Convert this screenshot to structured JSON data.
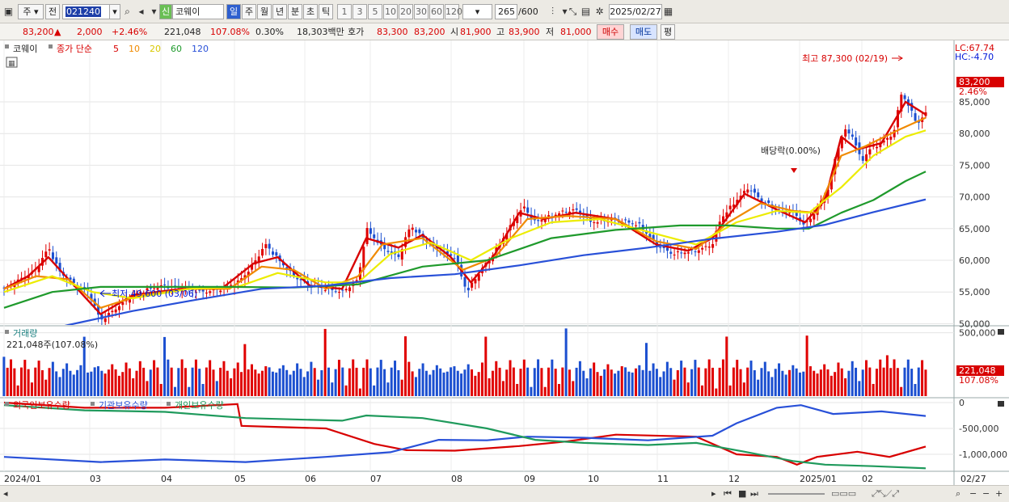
{
  "toolbar": {
    "period_unit": "주",
    "prev_label": "전",
    "code": "021240",
    "badge": "신",
    "name": "코웨이",
    "timeframes": [
      "일",
      "주",
      "월",
      "년",
      "분",
      "초",
      "틱"
    ],
    "numbers": [
      "1",
      "3",
      "5",
      "10",
      "20",
      "30",
      "60",
      "120"
    ],
    "count": "265",
    "count_total": "/600",
    "date": "2025/02/27"
  },
  "quote": {
    "price": "83,200",
    "arrow": "▲",
    "change": "2,000",
    "change_pct": "+2.46%",
    "volume": "221,048",
    "volume_pct": "107.08%",
    "turnover": "0.30%",
    "amount": "18,303백만",
    "ask_label": "호가",
    "ask": "83,300",
    "bid": "83,200",
    "open_label": "시",
    "open": "81,900",
    "high_label": "고",
    "high": "83,900",
    "low_label": "저",
    "low": "81,000",
    "buy_label": "매수",
    "sell_label": "매도",
    "extra_label": "평"
  },
  "price_panel": {
    "title": "코웨이",
    "legend_prefix": "종가 단순",
    "ma": [
      {
        "label": "5",
        "color": "#d80000"
      },
      {
        "label": "10",
        "color": "#f08a00"
      },
      {
        "label": "20",
        "color": "#e8e800"
      },
      {
        "label": "60",
        "color": "#1f9a2c"
      },
      {
        "label": "120",
        "color": "#2850d8"
      }
    ],
    "lc": "LC:67.74",
    "hc": "HC:-4.70",
    "yticks": [
      "85,000",
      "80,000",
      "75,000",
      "70,000",
      "65,000",
      "60,000",
      "55,000",
      "50,000"
    ],
    "last_price": "83,200",
    "last_pct": "2.46%",
    "high_note": "최고 87,300 (02/19)",
    "low_note": "최저 49,600 (03/06)",
    "dividend_note": "배당락(0.00%)"
  },
  "volume_panel": {
    "title": "거래량",
    "subtitle": "221,048주(107.08%)",
    "yticks": [
      "500,000"
    ],
    "last": "221,048",
    "last_pct": "107.08%"
  },
  "holding_panel": {
    "legend": [
      "외국인보유수량",
      "기관보유수량",
      "개인보유수량"
    ],
    "yticks": [
      "0",
      "-500,000",
      "-1,000,000"
    ]
  },
  "xaxis": [
    "2024/01",
    "03",
    "04",
    "05",
    "06",
    "07",
    "08",
    "09",
    "10",
    "11",
    "12",
    "2025/01",
    "02",
    "02/27"
  ],
  "chart_data": {
    "type": "line",
    "series": [
      {
        "name": "종가",
        "values": [
          [
            0,
            55500
          ],
          [
            20,
            57000
          ],
          [
            40,
            58500
          ],
          [
            55,
            62000
          ],
          [
            70,
            58000
          ],
          [
            90,
            56000
          ],
          [
            105,
            55000
          ],
          [
            120,
            50500
          ],
          [
            140,
            52500
          ],
          [
            160,
            54500
          ],
          [
            180,
            55500
          ],
          [
            200,
            56000
          ],
          [
            220,
            55500
          ],
          [
            250,
            55000
          ],
          [
            270,
            55500
          ],
          [
            290,
            56500
          ],
          [
            305,
            58500
          ],
          [
            325,
            62500
          ],
          [
            345,
            59500
          ],
          [
            360,
            57500
          ],
          [
            380,
            56000
          ],
          [
            400,
            55500
          ],
          [
            420,
            55000
          ],
          [
            440,
            57000
          ],
          [
            450,
            65000
          ],
          [
            470,
            62000
          ],
          [
            490,
            60500
          ],
          [
            505,
            65500
          ],
          [
            520,
            63500
          ],
          [
            540,
            61500
          ],
          [
            560,
            60500
          ],
          [
            575,
            55000
          ],
          [
            590,
            58000
          ],
          [
            610,
            61500
          ],
          [
            630,
            65500
          ],
          [
            645,
            68500
          ],
          [
            660,
            66000
          ],
          [
            690,
            67500
          ],
          [
            710,
            68000
          ],
          [
            730,
            66000
          ],
          [
            760,
            66500
          ],
          [
            790,
            65500
          ],
          [
            810,
            62500
          ],
          [
            830,
            61000
          ],
          [
            860,
            61500
          ],
          [
            880,
            62500
          ],
          [
            890,
            66500
          ],
          [
            910,
            69500
          ],
          [
            925,
            71500
          ],
          [
            940,
            69500
          ],
          [
            960,
            68000
          ],
          [
            980,
            67500
          ],
          [
            995,
            65500
          ],
          [
            1010,
            68000
          ],
          [
            1025,
            71500
          ],
          [
            1035,
            77500
          ],
          [
            1045,
            80500
          ],
          [
            1055,
            79500
          ],
          [
            1065,
            75500
          ],
          [
            1075,
            77500
          ],
          [
            1090,
            78500
          ],
          [
            1105,
            80000
          ],
          [
            1115,
            86500
          ],
          [
            1125,
            84000
          ],
          [
            1135,
            81500
          ],
          [
            1145,
            83200
          ]
        ]
      },
      {
        "name": "5",
        "values": [
          [
            0,
            55500
          ],
          [
            30,
            57500
          ],
          [
            55,
            60500
          ],
          [
            80,
            57000
          ],
          [
            120,
            51500
          ],
          [
            160,
            54500
          ],
          [
            220,
            55500
          ],
          [
            270,
            55500
          ],
          [
            310,
            59500
          ],
          [
            340,
            60500
          ],
          [
            380,
            56000
          ],
          [
            420,
            55500
          ],
          [
            450,
            63500
          ],
          [
            490,
            62000
          ],
          [
            520,
            64000
          ],
          [
            555,
            60500
          ],
          [
            580,
            56500
          ],
          [
            610,
            61000
          ],
          [
            640,
            67500
          ],
          [
            670,
            66500
          ],
          [
            710,
            67500
          ],
          [
            760,
            66500
          ],
          [
            810,
            62500
          ],
          [
            850,
            61500
          ],
          [
            880,
            63500
          ],
          [
            920,
            70500
          ],
          [
            960,
            68000
          ],
          [
            995,
            66000
          ],
          [
            1020,
            69500
          ],
          [
            1040,
            79500
          ],
          [
            1060,
            77500
          ],
          [
            1090,
            78500
          ],
          [
            1120,
            85000
          ],
          [
            1145,
            83000
          ]
        ]
      },
      {
        "name": "10",
        "values": [
          [
            0,
            55500
          ],
          [
            40,
            57500
          ],
          [
            80,
            57000
          ],
          [
            120,
            52500
          ],
          [
            170,
            54500
          ],
          [
            230,
            55500
          ],
          [
            280,
            55500
          ],
          [
            320,
            59000
          ],
          [
            360,
            58500
          ],
          [
            400,
            55500
          ],
          [
            440,
            57500
          ],
          [
            470,
            62500
          ],
          [
            520,
            63500
          ],
          [
            570,
            58500
          ],
          [
            610,
            60500
          ],
          [
            650,
            66500
          ],
          [
            700,
            67000
          ],
          [
            760,
            66500
          ],
          [
            810,
            63000
          ],
          [
            860,
            61800
          ],
          [
            900,
            66000
          ],
          [
            940,
            69000
          ],
          [
            980,
            67800
          ],
          [
            1010,
            67500
          ],
          [
            1040,
            76500
          ],
          [
            1070,
            78000
          ],
          [
            1110,
            80500
          ],
          [
            1145,
            82500
          ]
        ]
      },
      {
        "name": "20",
        "values": [
          [
            0,
            55000
          ],
          [
            60,
            57500
          ],
          [
            110,
            55000
          ],
          [
            160,
            54000
          ],
          [
            230,
            55500
          ],
          [
            290,
            55800
          ],
          [
            340,
            58000
          ],
          [
            400,
            56500
          ],
          [
            440,
            56500
          ],
          [
            480,
            61000
          ],
          [
            530,
            62800
          ],
          [
            580,
            60000
          ],
          [
            630,
            63500
          ],
          [
            680,
            66000
          ],
          [
            740,
            66500
          ],
          [
            800,
            64500
          ],
          [
            860,
            62500
          ],
          [
            910,
            66000
          ],
          [
            960,
            67800
          ],
          [
            1000,
            67500
          ],
          [
            1040,
            71500
          ],
          [
            1080,
            76500
          ],
          [
            1120,
            79500
          ],
          [
            1145,
            80500
          ]
        ]
      },
      {
        "name": "60",
        "values": [
          [
            0,
            52500
          ],
          [
            60,
            55000
          ],
          [
            120,
            55800
          ],
          [
            200,
            55800
          ],
          [
            280,
            55800
          ],
          [
            360,
            55700
          ],
          [
            440,
            56200
          ],
          [
            520,
            59000
          ],
          [
            600,
            60000
          ],
          [
            680,
            63500
          ],
          [
            760,
            64800
          ],
          [
            840,
            65500
          ],
          [
            900,
            65500
          ],
          [
            960,
            65000
          ],
          [
            1000,
            65000
          ],
          [
            1040,
            67500
          ],
          [
            1080,
            69500
          ],
          [
            1120,
            72500
          ],
          [
            1145,
            74000
          ]
        ]
      },
      {
        "name": "120",
        "values": [
          [
            0,
            47500
          ],
          [
            80,
            49800
          ],
          [
            160,
            52000
          ],
          [
            240,
            53800
          ],
          [
            320,
            55500
          ],
          [
            400,
            56000
          ],
          [
            480,
            57200
          ],
          [
            560,
            57800
          ],
          [
            640,
            59200
          ],
          [
            720,
            60800
          ],
          [
            800,
            62000
          ],
          [
            880,
            63400
          ],
          [
            960,
            64500
          ],
          [
            1020,
            65600
          ],
          [
            1080,
            67600
          ],
          [
            1145,
            69600
          ]
        ]
      }
    ],
    "holdings": [
      {
        "name": "외국인보유수량",
        "values": [
          [
            0,
            0
          ],
          [
            100,
            -100000
          ],
          [
            200,
            -100000
          ],
          [
            290,
            -30000
          ],
          [
            295,
            -450000
          ],
          [
            400,
            -500000
          ],
          [
            460,
            -800000
          ],
          [
            500,
            -920000
          ],
          [
            560,
            -930000
          ],
          [
            640,
            -840000
          ],
          [
            700,
            -750000
          ],
          [
            760,
            -620000
          ],
          [
            860,
            -660000
          ],
          [
            910,
            -1000000
          ],
          [
            960,
            -1050000
          ],
          [
            985,
            -1200000
          ],
          [
            1010,
            -1050000
          ],
          [
            1060,
            -950000
          ],
          [
            1100,
            -1050000
          ],
          [
            1145,
            -850000
          ]
        ]
      },
      {
        "name": "기관보유수량",
        "values": [
          [
            0,
            -1050000
          ],
          [
            120,
            -1150000
          ],
          [
            200,
            -1100000
          ],
          [
            300,
            -1150000
          ],
          [
            400,
            -1050000
          ],
          [
            480,
            -960000
          ],
          [
            540,
            -720000
          ],
          [
            600,
            -730000
          ],
          [
            650,
            -660000
          ],
          [
            720,
            -680000
          ],
          [
            800,
            -730000
          ],
          [
            880,
            -640000
          ],
          [
            910,
            -400000
          ],
          [
            960,
            -100000
          ],
          [
            990,
            -50000
          ],
          [
            1030,
            -220000
          ],
          [
            1090,
            -170000
          ],
          [
            1145,
            -260000
          ]
        ]
      },
      {
        "name": "개인보유수량",
        "values": [
          [
            0,
            -50000
          ],
          [
            100,
            -150000
          ],
          [
            200,
            -180000
          ],
          [
            300,
            -300000
          ],
          [
            420,
            -350000
          ],
          [
            450,
            -250000
          ],
          [
            520,
            -300000
          ],
          [
            600,
            -500000
          ],
          [
            660,
            -720000
          ],
          [
            720,
            -780000
          ],
          [
            800,
            -820000
          ],
          [
            860,
            -780000
          ],
          [
            920,
            -950000
          ],
          [
            980,
            -1130000
          ],
          [
            1020,
            -1200000
          ],
          [
            1080,
            -1230000
          ],
          [
            1145,
            -1270000
          ]
        ]
      }
    ]
  }
}
